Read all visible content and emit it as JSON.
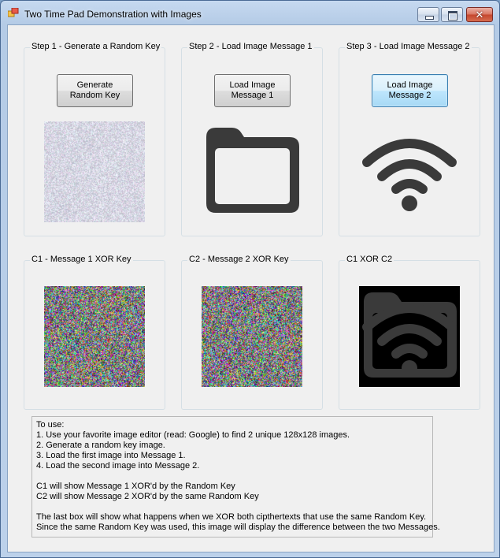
{
  "window": {
    "title": "Two Time Pad Demonstration with Images"
  },
  "groups": {
    "step1": {
      "caption": "Step 1 - Generate a Random Key",
      "button": "Generate\nRandom Key"
    },
    "step2": {
      "caption": "Step 2 - Load Image Message 1",
      "button": "Load Image\nMessage 1"
    },
    "step3": {
      "caption": "Step 3 - Load Image Message 2",
      "button": "Load Image\nMessage 2"
    },
    "c1": {
      "caption": "C1 - Message 1 XOR Key"
    },
    "c2": {
      "caption": "C2 - Message 2 XOR Key"
    },
    "c1xorc2": {
      "caption": "C1 XOR C2"
    }
  },
  "images": {
    "random_key": "grayscale-noise",
    "message1": "folder-icon",
    "message2": "wifi-icon",
    "c1": "color-noise",
    "c2": "color-noise",
    "c1xorc2": "folder-wifi-overlay"
  },
  "colors": {
    "icon": "#3a3a3a",
    "panel": "#f0f0f0"
  },
  "instructions": {
    "lines": [
      "To use:",
      "1. Use your favorite image editor (read: Google) to find 2 unique 128x128 images.",
      "2. Generate a random key image.",
      "3. Load the first image into Message 1.",
      "4. Load the second image into Message 2.",
      "",
      "C1 will show Message 1 XOR'd by the Random Key",
      "C2 will show Message 2 XOR'd by the same Random Key",
      "",
      "The last box will show what happens when we XOR both cipthertexts that use the same Random Key.",
      "Since the same Random Key was used, this image will display the difference between the two Messages."
    ]
  }
}
